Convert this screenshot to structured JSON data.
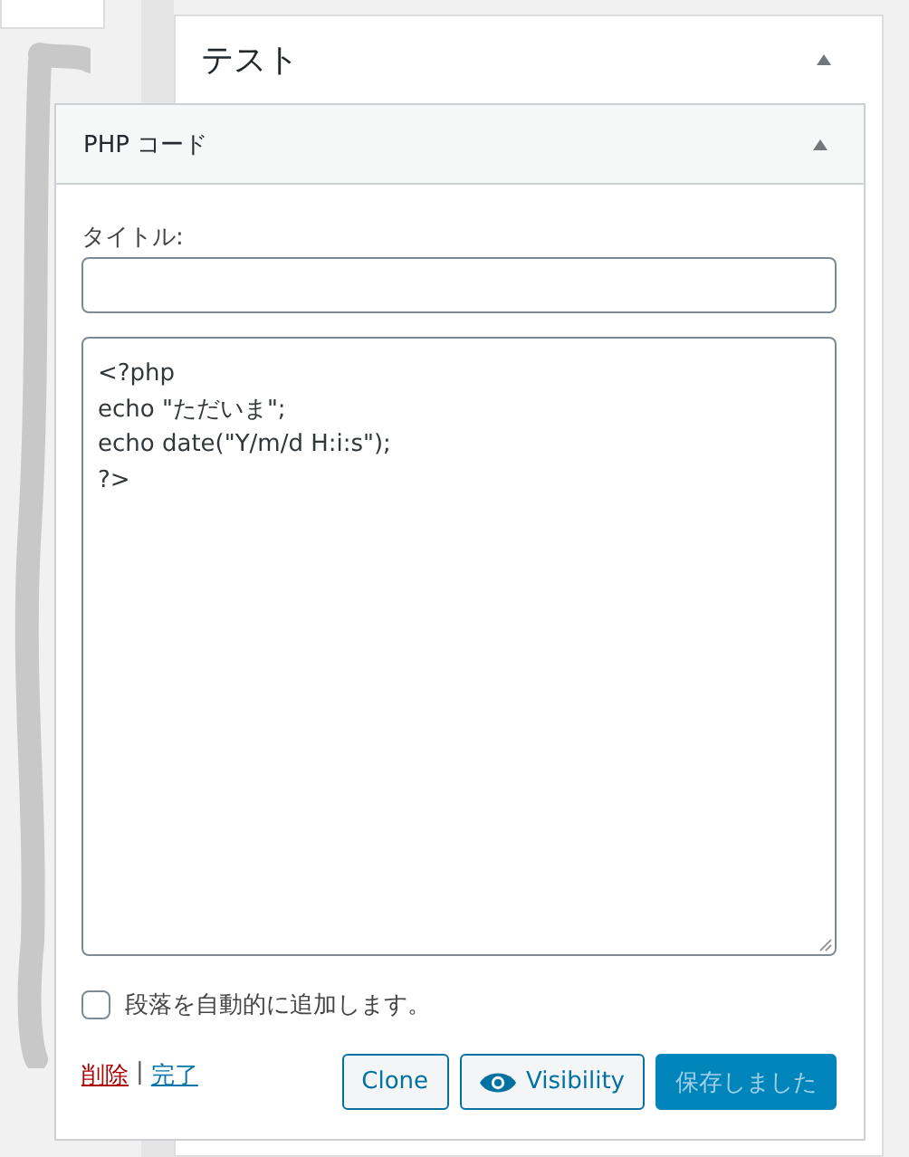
{
  "panel": {
    "title": "テスト",
    "expanded": true
  },
  "widget": {
    "title": "PHP コード",
    "expanded": true,
    "title_label": "タイトル:",
    "code": "<?php\necho \"ただいま\";\necho date(\"Y/m/d H:i:s\");\n?>"
  },
  "auto_paragraph": {
    "label": "段落を自動的に追加します。",
    "checked": false
  },
  "links": [
    {
      "label": "削除",
      "kind": "delete"
    },
    {
      "label": "完了",
      "kind": "done"
    }
  ],
  "link_separator": "|",
  "buttons": [
    {
      "label": "Clone",
      "kind": "plain"
    },
    {
      "label": "Visibility",
      "kind": "eye"
    },
    {
      "label": "保存しました",
      "kind": "primary",
      "disabled": true
    }
  ]
}
